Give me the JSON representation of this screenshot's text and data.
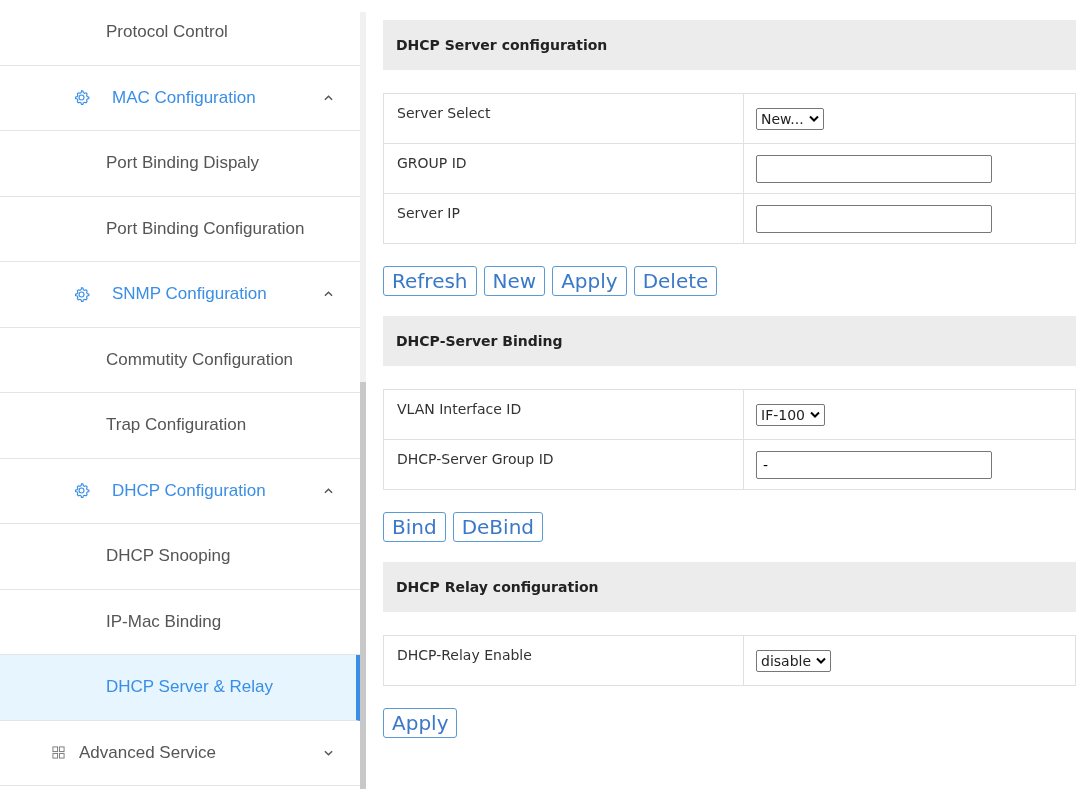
{
  "sidebar": {
    "items": [
      {
        "kind": "sub",
        "label": "Protocol Control",
        "selected": false
      },
      {
        "kind": "group",
        "label": "MAC Configuration",
        "expanded": true,
        "selected": false
      },
      {
        "kind": "sub",
        "label": "Port Binding Dispaly",
        "selected": false
      },
      {
        "kind": "sub",
        "label": "Port Binding Configuration",
        "selected": false
      },
      {
        "kind": "group",
        "label": "SNMP Configuration",
        "expanded": true,
        "selected": false
      },
      {
        "kind": "sub",
        "label": "Commutity Configuration",
        "selected": false
      },
      {
        "kind": "sub",
        "label": "Trap Configuration",
        "selected": false
      },
      {
        "kind": "group",
        "label": "DHCP Configuration",
        "expanded": true,
        "selected": false
      },
      {
        "kind": "sub",
        "label": "DHCP Snooping",
        "selected": false
      },
      {
        "kind": "sub",
        "label": "IP-Mac Binding",
        "selected": false
      },
      {
        "kind": "sub",
        "label": "DHCP Server & Relay",
        "selected": true
      },
      {
        "kind": "section",
        "label": "Advanced Service",
        "expanded": false,
        "selected": false
      }
    ]
  },
  "sections": [
    {
      "title": "DHCP Server configuration",
      "rows": [
        {
          "label": "Server Select",
          "kind": "select",
          "value": "New..."
        },
        {
          "label": "GROUP ID",
          "kind": "text",
          "value": ""
        },
        {
          "label": "Server IP",
          "kind": "text",
          "value": ""
        }
      ],
      "buttons": [
        "Refresh",
        "New",
        "Apply",
        "Delete"
      ]
    },
    {
      "title": "DHCP-Server Binding",
      "rows": [
        {
          "label": "VLAN Interface ID",
          "kind": "select",
          "value": "IF-100"
        },
        {
          "label": "DHCP-Server Group ID",
          "kind": "text",
          "value": "-"
        }
      ],
      "buttons": [
        "Bind",
        "DeBind"
      ]
    },
    {
      "title": "DHCP Relay configuration",
      "rows": [
        {
          "label": "DHCP-Relay Enable",
          "kind": "select",
          "value": "disable"
        }
      ],
      "buttons": [
        "Apply"
      ]
    }
  ]
}
